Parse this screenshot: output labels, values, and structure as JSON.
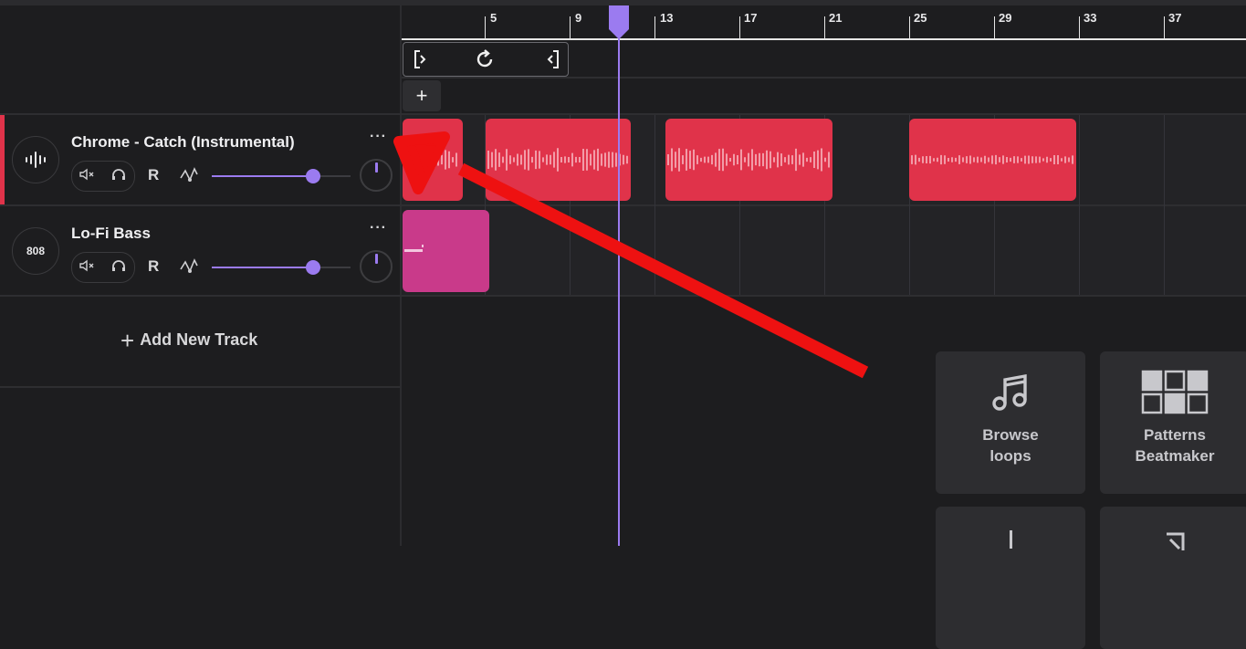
{
  "ruler": {
    "bars": [
      "5",
      "9",
      "13",
      "17",
      "21",
      "25",
      "29",
      "33",
      "37"
    ]
  },
  "loop_controls": {
    "start_icon": "bracket-start-icon",
    "loop_icon": "loop-icon",
    "end_icon": "bracket-end-icon"
  },
  "add_button": {
    "label": "+"
  },
  "tracks": [
    {
      "name": "Chrome - Catch (Instrumental)",
      "avatar": "waveform-icon",
      "menu": "···",
      "record_label": "R",
      "volume": 0.73,
      "color": "#e0334a",
      "selected": true
    },
    {
      "name": "Lo-Fi Bass",
      "avatar_text": "808",
      "menu": "···",
      "record_label": "R",
      "volume": 0.73,
      "color": "#c93a8a",
      "selected": false
    }
  ],
  "add_track": {
    "label": "Add New Track"
  },
  "cards": [
    {
      "label": "Browse\nloops",
      "icon": "music-note-icon"
    },
    {
      "label": "Patterns\nBeatmaker",
      "icon": "pattern-grid-icon"
    }
  ],
  "colors": {
    "accent": "#9b7bf0",
    "clip_red": "#e0334a",
    "clip_pink": "#c93a8a",
    "annotation_arrow": "#ee1111"
  }
}
